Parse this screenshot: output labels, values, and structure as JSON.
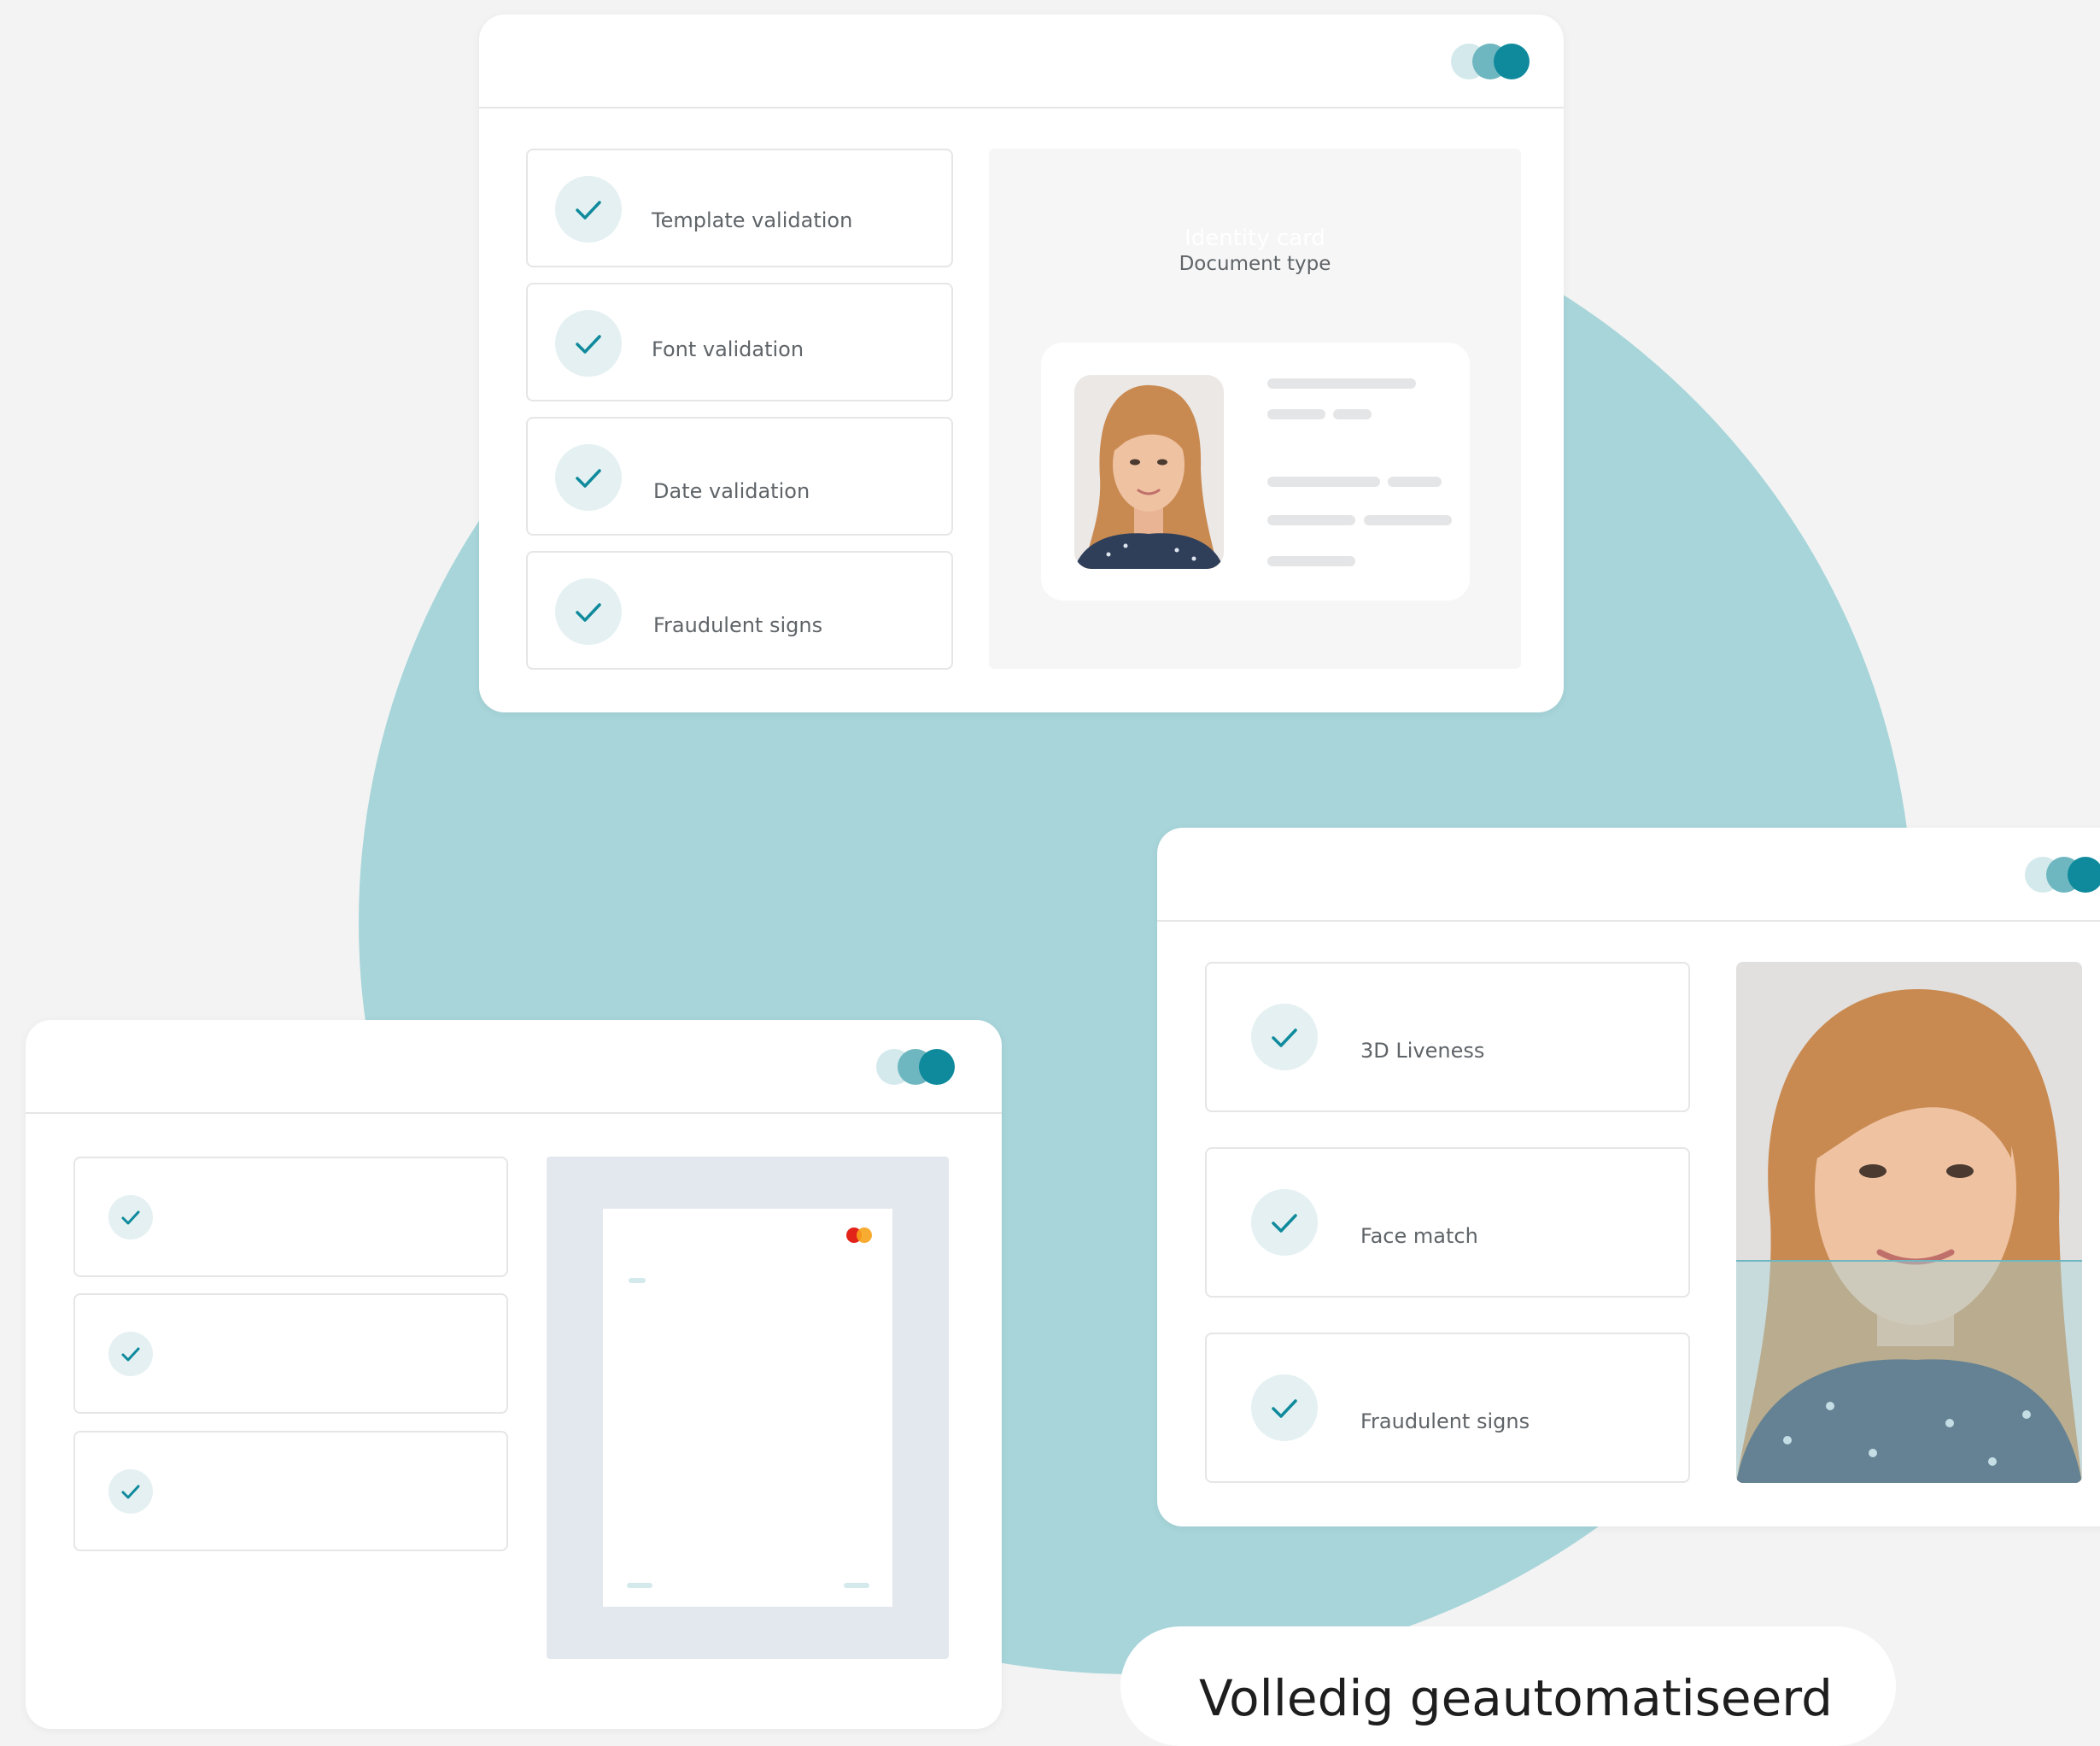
{
  "colors": {
    "background": "#f3f3f3",
    "blob": "#a7d5da",
    "accent": "#0e8a9c",
    "check_bg": "#e4f0f1",
    "window_dots": [
      "#d3e9ec",
      "#6fb7c0",
      "#0e8a9c"
    ]
  },
  "document_card": {
    "checks": [
      {
        "label": "Template validation",
        "icon": "check-icon"
      },
      {
        "label": "Font validation",
        "icon": "check-icon"
      },
      {
        "label": "Date validation",
        "icon": "check-icon"
      },
      {
        "label": "Fraudulent signs",
        "icon": "check-icon"
      }
    ],
    "preview": {
      "document_name": "Identity card",
      "document_type_label": "Document type",
      "photo_icon": "portrait-photo"
    }
  },
  "bank_card": {
    "check_count": 3,
    "check_icon": "check-icon",
    "preview_icon": "mastercard-logo"
  },
  "face_card": {
    "checks": [
      {
        "label": "3D Liveness",
        "icon": "check-icon"
      },
      {
        "label": "Face match",
        "icon": "check-icon"
      },
      {
        "label": "Fraudulent signs",
        "icon": "check-icon"
      }
    ],
    "photo_icon": "face-scan-photo"
  },
  "caption": {
    "text": "Volledig geautomatiseerd"
  }
}
